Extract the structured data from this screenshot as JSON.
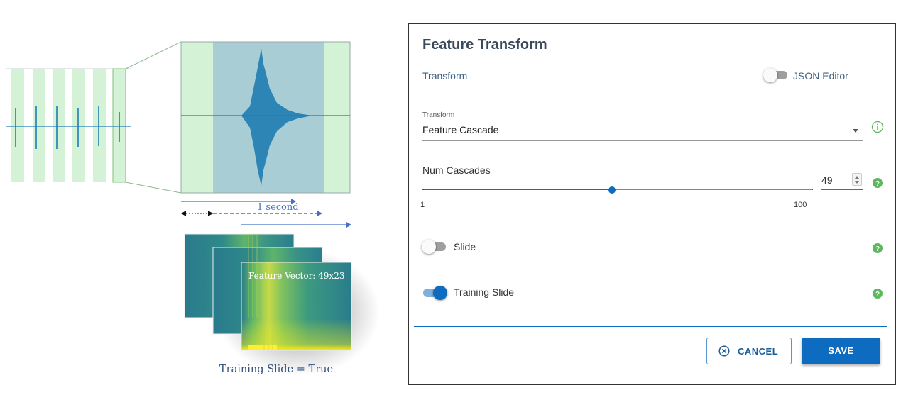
{
  "illustration": {
    "time_label": "1 second",
    "feature_vector_label": "Feature Vector: 49x23",
    "caption": "Training Slide = True"
  },
  "dialog": {
    "title": "Feature Transform",
    "section_label": "Transform",
    "json_editor": {
      "label": "JSON Editor",
      "enabled": false
    },
    "transform_select": {
      "label": "Transform",
      "value": "Feature Cascade",
      "icon": "info-icon"
    },
    "num_cascades": {
      "label": "Num Cascades",
      "value": "49",
      "min": "1",
      "max": "100",
      "icon": "help-icon"
    },
    "slide": {
      "label": "Slide",
      "enabled": false
    },
    "training_slide": {
      "label": "Training Slide",
      "enabled": true
    },
    "cancel_label": "CANCEL",
    "save_label": "SAVE"
  },
  "colors": {
    "accent": "#0d6cc0",
    "help_green": "#5cb85c",
    "title": "#3a4a5c"
  }
}
